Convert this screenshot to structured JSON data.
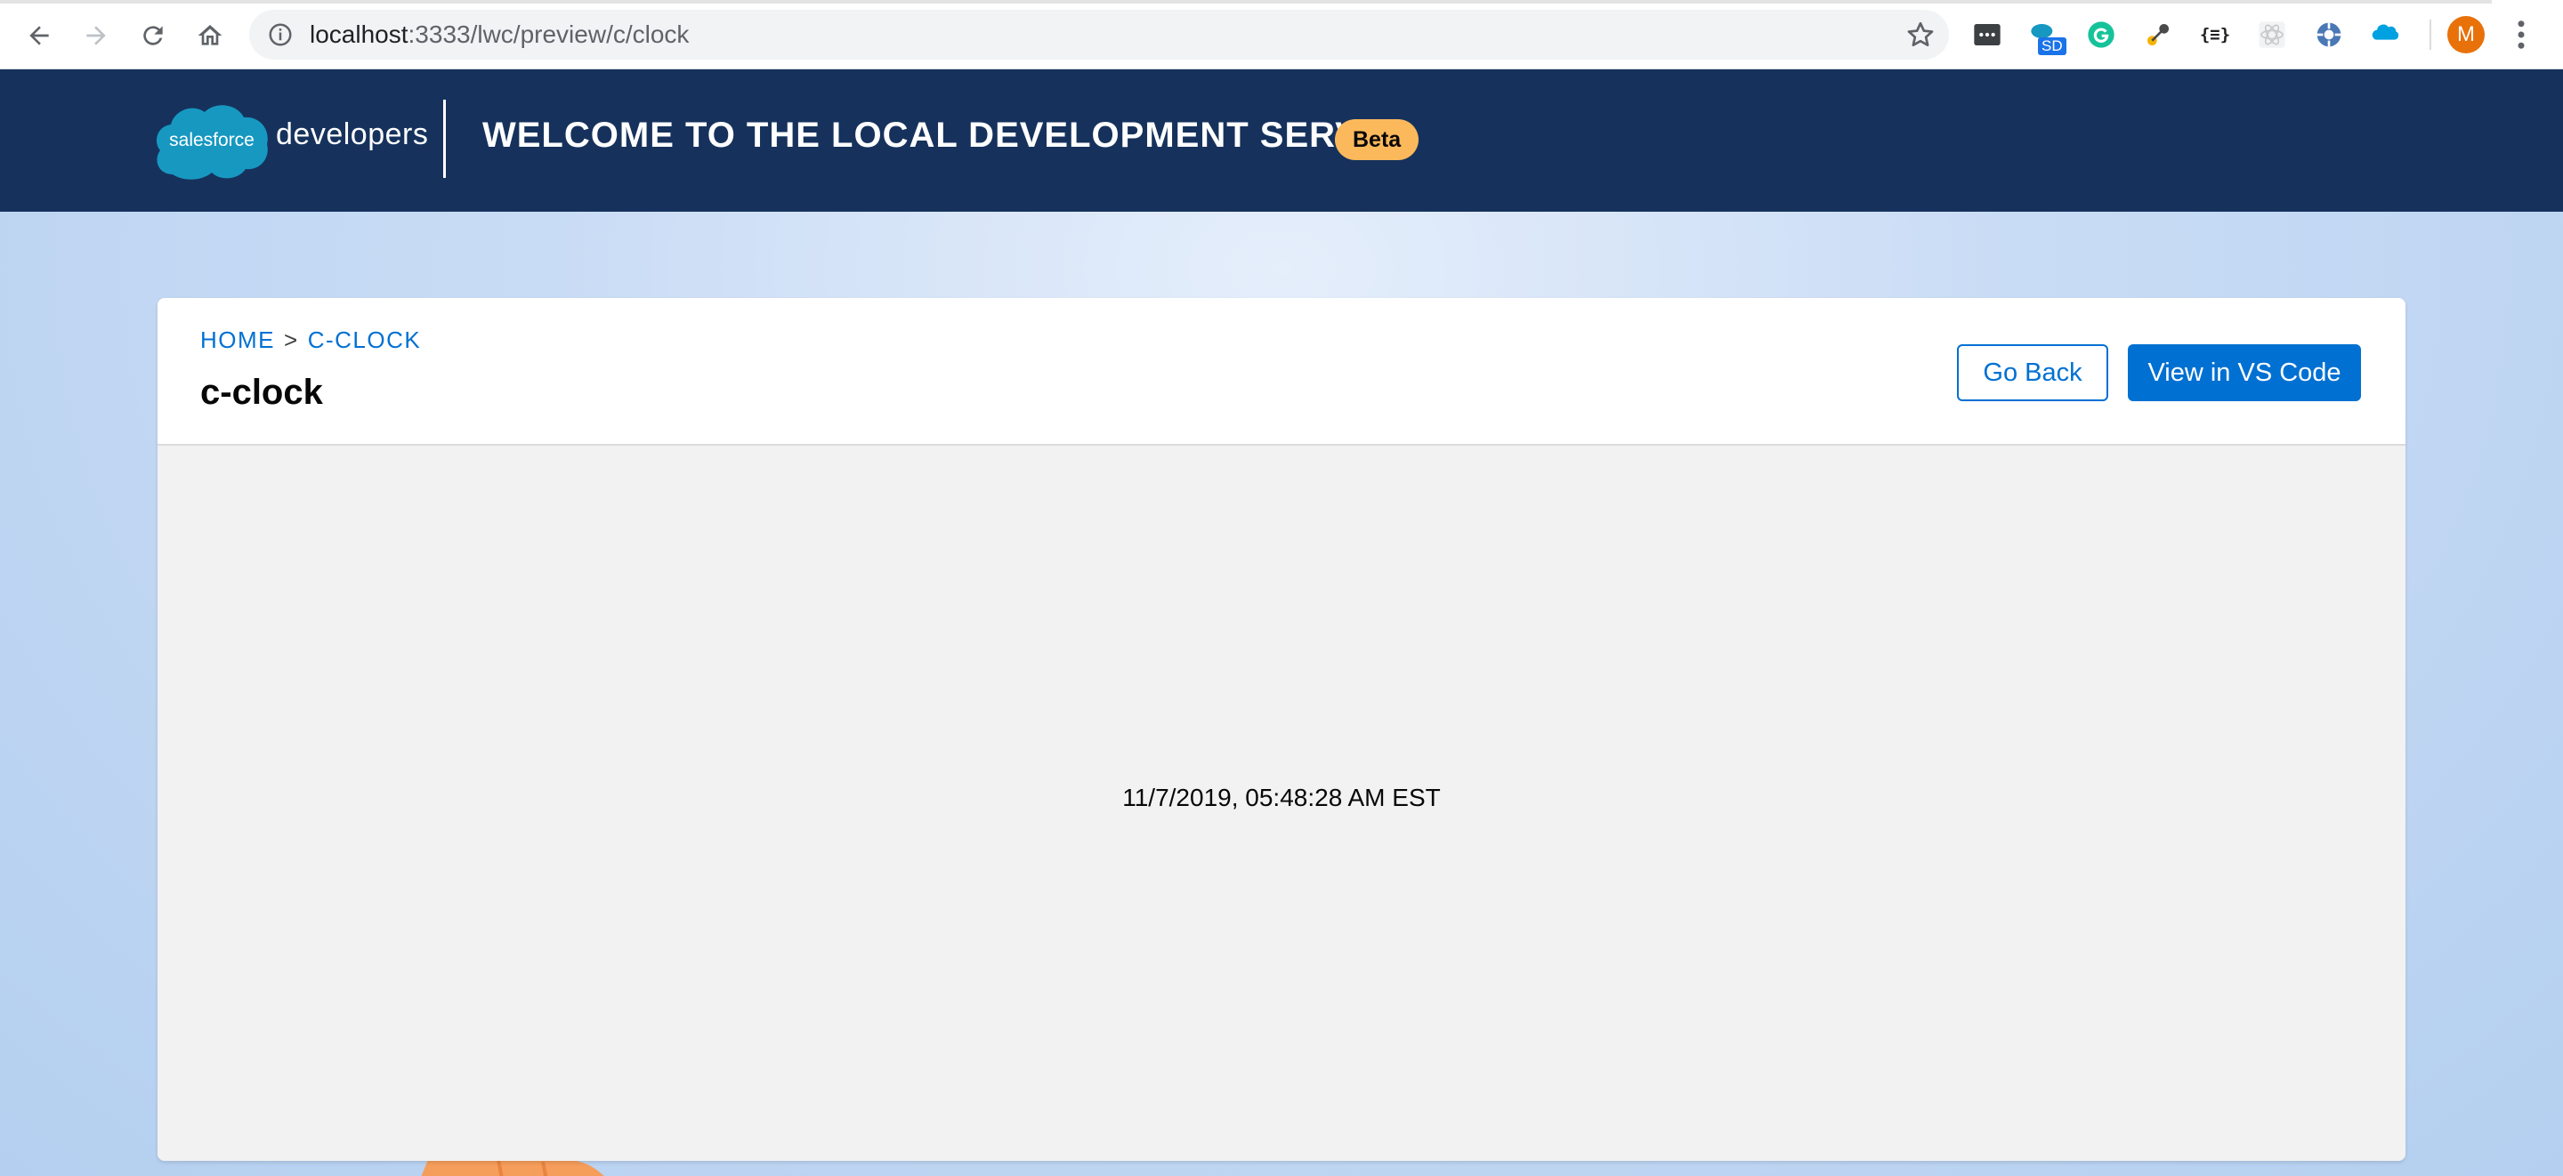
{
  "browser": {
    "url_host": "localhost",
    "url_rest": ":3333/lwc/preview/c/clock",
    "extensions": [
      "terminal-ext-icon",
      "salesforce-sd-ext-icon",
      "grammarly-ext-icon",
      "tracker-ext-icon",
      "json-formatter-ext-icon",
      "react-devtools-ext-icon",
      "settings-ext-icon",
      "salesforce-ext-icon"
    ],
    "sd_badge": "SD",
    "json_ext_label": "{≡}",
    "profile_initial": "M"
  },
  "header": {
    "logo_cloud_text": "salesforce",
    "logo_text": "developers",
    "title": "WELCOME TO THE LOCAL DEVELOPMENT SERVER",
    "badge": "Beta"
  },
  "card": {
    "breadcrumb": {
      "home": "HOME",
      "separator": ">",
      "current": "C-CLOCK"
    },
    "title": "c-clock",
    "buttons": {
      "go_back": "Go Back",
      "view_in_vscode": "View in VS Code"
    }
  },
  "preview": {
    "clock_text": "11/7/2019, 05:48:28 AM EST"
  },
  "colors": {
    "header_bg": "#16325c",
    "brand_blue": "#0070d2",
    "beta_badge": "#fcb95b",
    "preview_bg": "#f2f2f2"
  }
}
